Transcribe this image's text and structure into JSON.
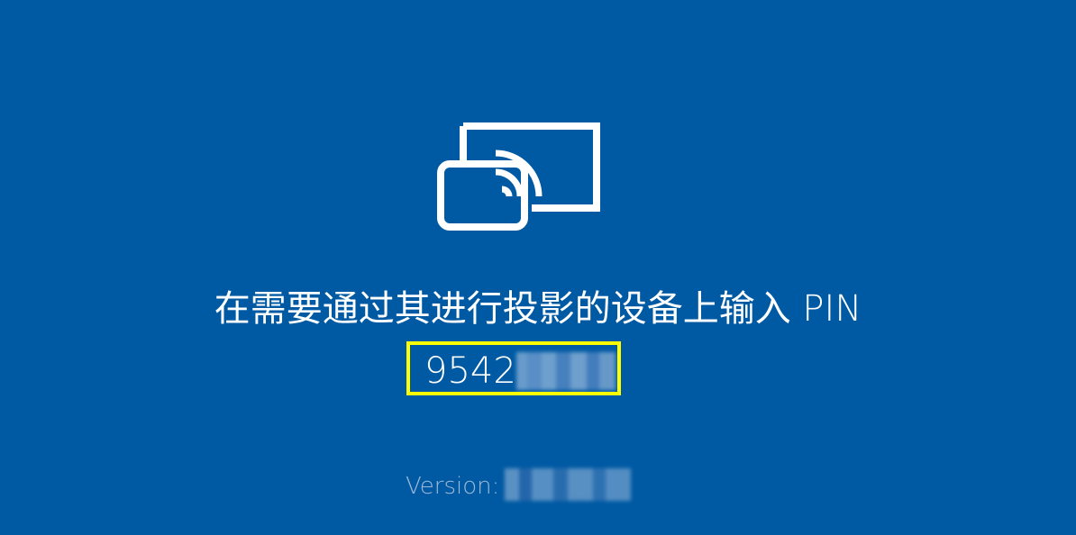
{
  "screen": {
    "background_color": "#005aa3",
    "icon": "cast-to-device-icon",
    "prompt": "在需要通过其进行投影的设备上输入 PIN",
    "pin_visible": "9542",
    "pin_highlight_color": "#ffff00",
    "version_label": "Version:"
  }
}
